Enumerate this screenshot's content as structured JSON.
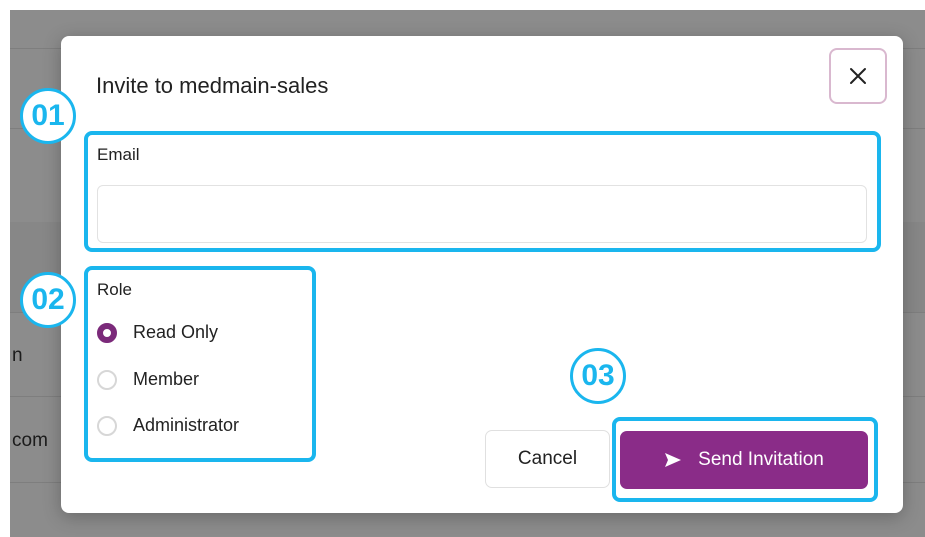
{
  "background": {
    "row_text_1": "n",
    "row_text_2": "com"
  },
  "modal": {
    "title": "Invite to medmain-sales",
    "close_icon": "close-icon"
  },
  "email": {
    "label": "Email",
    "value": "",
    "placeholder": ""
  },
  "role": {
    "label": "Role",
    "selected": "Read Only",
    "options": [
      {
        "label": "Read Only",
        "checked": true
      },
      {
        "label": "Member",
        "checked": false
      },
      {
        "label": "Administrator",
        "checked": false
      }
    ]
  },
  "actions": {
    "cancel_label": "Cancel",
    "send_label": "Send Invitation",
    "send_icon": "send-arrow-icon"
  },
  "callouts": {
    "first": "01",
    "second": "02",
    "third": "03"
  },
  "colors": {
    "accent": "#8a2c88",
    "callout": "#1ab6ee",
    "radio_checked": "#7b2a7a"
  }
}
